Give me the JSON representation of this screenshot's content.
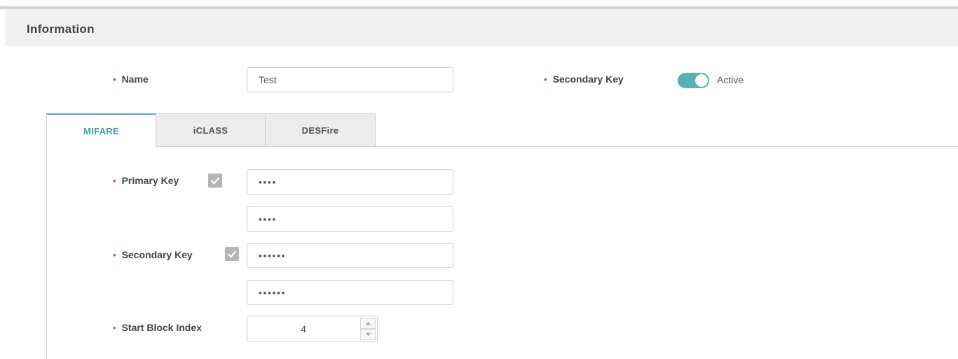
{
  "section": {
    "title": "Information"
  },
  "form": {
    "name": {
      "label": "Name",
      "value": "Test"
    },
    "secondary_key_toggle": {
      "label": "Secondary Key",
      "state_label": "Active",
      "on": true
    }
  },
  "tabs": [
    {
      "label": "MIFARE",
      "active": true
    },
    {
      "label": "iCLASS",
      "active": false
    },
    {
      "label": "DESFire",
      "active": false
    }
  ],
  "mifare": {
    "primary_key": {
      "label": "Primary Key",
      "checked": true,
      "value": "••••",
      "confirm_value": "••••"
    },
    "secondary_key": {
      "label": "Secondary Key",
      "checked": true,
      "value": "••••••",
      "confirm_value": "••••••"
    },
    "start_block_index": {
      "label": "Start Block Index",
      "value": "4"
    }
  },
  "required_marker": "•",
  "colors": {
    "accent": "#54b3b5",
    "required": "#e0524a",
    "header_bg": "#f1f1f1"
  },
  "icons": {
    "check": "check-icon",
    "spin_up": "chevron-up-icon",
    "spin_down": "chevron-down-icon"
  }
}
